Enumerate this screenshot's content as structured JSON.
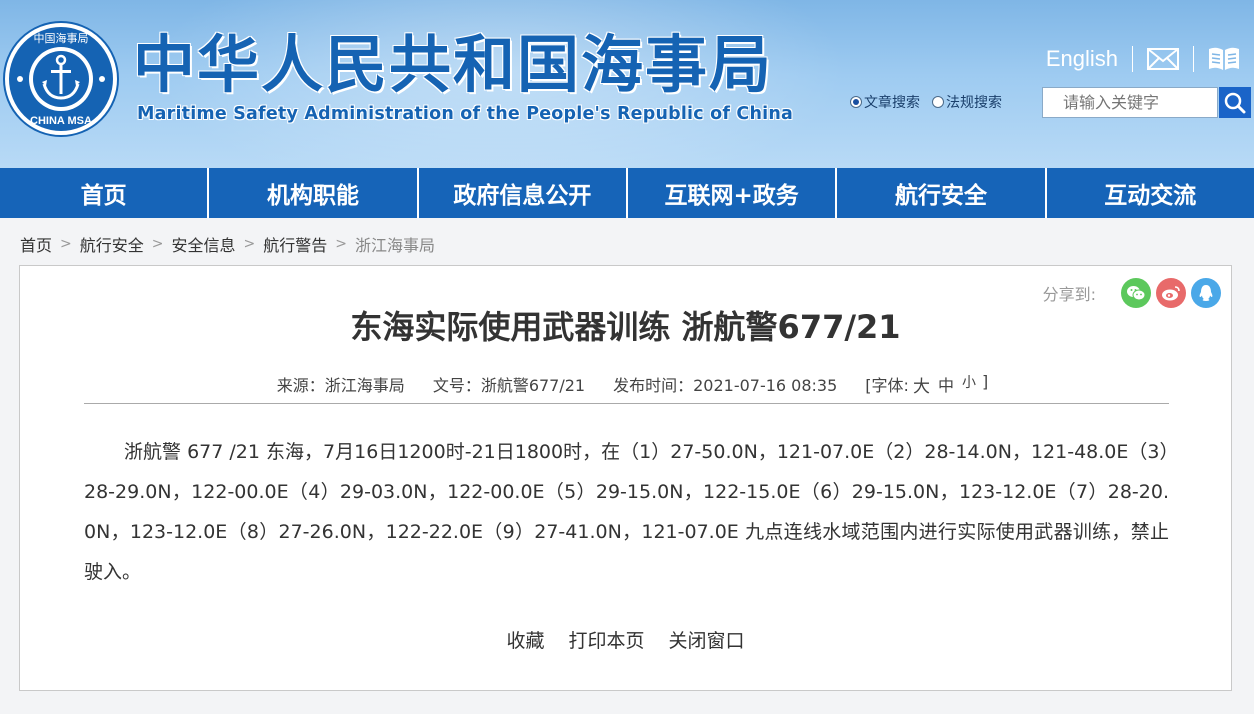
{
  "header": {
    "title_cn": "中华人民共和国海事局",
    "title_en": "Maritime Safety Administration of the People's Republic of China",
    "logo_text": "中国海事局",
    "logo_en": "CHINA MSA",
    "english_link": "English"
  },
  "search": {
    "option_article": "文章搜索",
    "option_law": "法规搜索",
    "selected": "文章搜索",
    "placeholder": "请输入关键字"
  },
  "nav": {
    "items": [
      "首页",
      "机构职能",
      "政府信息公开",
      "互联网+政务",
      "航行安全",
      "互动交流"
    ]
  },
  "breadcrumb": {
    "items": [
      "首页",
      "航行安全",
      "安全信息",
      "航行警告",
      "浙江海事局"
    ],
    "separator": ">"
  },
  "article": {
    "share_label": "分享到:",
    "title": "东海实际使用武器训练 浙航警677/21",
    "source": "来源：浙江海事局",
    "doc_no": "文号：浙航警677/21",
    "publish_time": "发布时间：2021-07-16 08:35",
    "font_label_open": "[字体:",
    "font_large": "大",
    "font_medium": "中",
    "font_small": "小",
    "font_label_close": "]",
    "body": "浙航警 677 /21 东海，7月16日1200时-21日1800时，在（1）27-50.0N，121-07.0E（2）28-14.0N，121-48.0E（3）28-29.0N，122-00.0E（4）29-03.0N，122-00.0E（5）29-15.0N，122-15.0E（6）29-15.0N，123-12.0E（7）28-20.0N，123-12.0E（8）27-26.0N，122-22.0E（9）27-41.0N，121-07.0E 九点连线水域范围内进行实际使用武器训练，禁止驶入。",
    "actions": {
      "favorite": "收藏",
      "print": "打印本页",
      "close": "关闭窗口"
    }
  },
  "colors": {
    "brand_blue": "#1563b3",
    "nav_blue": "#1664b8",
    "wechat_green": "#5cc85c",
    "weibo_red": "#e86a6a",
    "qq_blue": "#4aa8e8"
  }
}
